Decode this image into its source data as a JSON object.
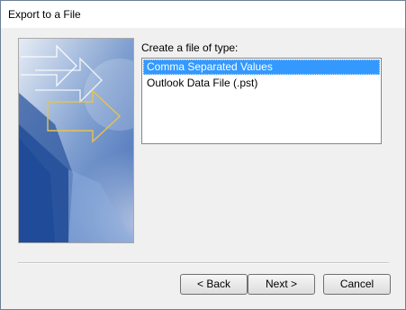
{
  "window": {
    "title": "Export to a File"
  },
  "prompt_label": "Create a file of type:",
  "file_types": [
    {
      "label": "Comma Separated Values",
      "selected": true
    },
    {
      "label": "Outlook Data File (.pst)",
      "selected": false
    }
  ],
  "buttons": {
    "back": "< Back",
    "next": "Next >",
    "cancel": "Cancel"
  },
  "colors": {
    "selection": "#3399ff",
    "wizard_blue": "#2e579f",
    "arrow_gold": "#e8c34a"
  },
  "icons": [
    "wizard-arrows-graphic"
  ]
}
